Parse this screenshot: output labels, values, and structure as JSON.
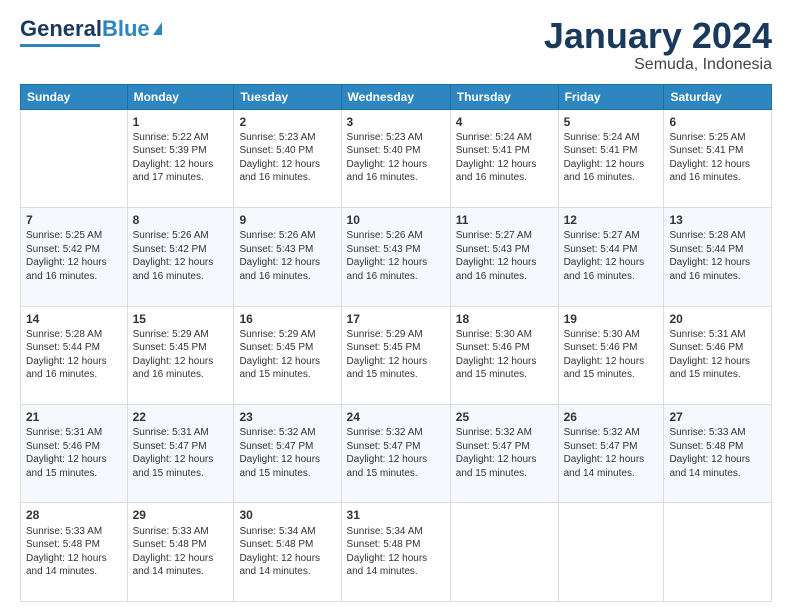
{
  "header": {
    "logo": {
      "text_general": "General",
      "text_blue": "Blue"
    },
    "title": "January 2024",
    "subtitle": "Semuda, Indonesia"
  },
  "calendar": {
    "days_header": [
      "Sunday",
      "Monday",
      "Tuesday",
      "Wednesday",
      "Thursday",
      "Friday",
      "Saturday"
    ],
    "weeks": [
      [
        {
          "day": "",
          "info": ""
        },
        {
          "day": "1",
          "info": "Sunrise: 5:22 AM\nSunset: 5:39 PM\nDaylight: 12 hours\nand 17 minutes."
        },
        {
          "day": "2",
          "info": "Sunrise: 5:23 AM\nSunset: 5:40 PM\nDaylight: 12 hours\nand 16 minutes."
        },
        {
          "day": "3",
          "info": "Sunrise: 5:23 AM\nSunset: 5:40 PM\nDaylight: 12 hours\nand 16 minutes."
        },
        {
          "day": "4",
          "info": "Sunrise: 5:24 AM\nSunset: 5:41 PM\nDaylight: 12 hours\nand 16 minutes."
        },
        {
          "day": "5",
          "info": "Sunrise: 5:24 AM\nSunset: 5:41 PM\nDaylight: 12 hours\nand 16 minutes."
        },
        {
          "day": "6",
          "info": "Sunrise: 5:25 AM\nSunset: 5:41 PM\nDaylight: 12 hours\nand 16 minutes."
        }
      ],
      [
        {
          "day": "7",
          "info": "Sunrise: 5:25 AM\nSunset: 5:42 PM\nDaylight: 12 hours\nand 16 minutes."
        },
        {
          "day": "8",
          "info": "Sunrise: 5:26 AM\nSunset: 5:42 PM\nDaylight: 12 hours\nand 16 minutes."
        },
        {
          "day": "9",
          "info": "Sunrise: 5:26 AM\nSunset: 5:43 PM\nDaylight: 12 hours\nand 16 minutes."
        },
        {
          "day": "10",
          "info": "Sunrise: 5:26 AM\nSunset: 5:43 PM\nDaylight: 12 hours\nand 16 minutes."
        },
        {
          "day": "11",
          "info": "Sunrise: 5:27 AM\nSunset: 5:43 PM\nDaylight: 12 hours\nand 16 minutes."
        },
        {
          "day": "12",
          "info": "Sunrise: 5:27 AM\nSunset: 5:44 PM\nDaylight: 12 hours\nand 16 minutes."
        },
        {
          "day": "13",
          "info": "Sunrise: 5:28 AM\nSunset: 5:44 PM\nDaylight: 12 hours\nand 16 minutes."
        }
      ],
      [
        {
          "day": "14",
          "info": "Sunrise: 5:28 AM\nSunset: 5:44 PM\nDaylight: 12 hours\nand 16 minutes."
        },
        {
          "day": "15",
          "info": "Sunrise: 5:29 AM\nSunset: 5:45 PM\nDaylight: 12 hours\nand 16 minutes."
        },
        {
          "day": "16",
          "info": "Sunrise: 5:29 AM\nSunset: 5:45 PM\nDaylight: 12 hours\nand 15 minutes."
        },
        {
          "day": "17",
          "info": "Sunrise: 5:29 AM\nSunset: 5:45 PM\nDaylight: 12 hours\nand 15 minutes."
        },
        {
          "day": "18",
          "info": "Sunrise: 5:30 AM\nSunset: 5:46 PM\nDaylight: 12 hours\nand 15 minutes."
        },
        {
          "day": "19",
          "info": "Sunrise: 5:30 AM\nSunset: 5:46 PM\nDaylight: 12 hours\nand 15 minutes."
        },
        {
          "day": "20",
          "info": "Sunrise: 5:31 AM\nSunset: 5:46 PM\nDaylight: 12 hours\nand 15 minutes."
        }
      ],
      [
        {
          "day": "21",
          "info": "Sunrise: 5:31 AM\nSunset: 5:46 PM\nDaylight: 12 hours\nand 15 minutes."
        },
        {
          "day": "22",
          "info": "Sunrise: 5:31 AM\nSunset: 5:47 PM\nDaylight: 12 hours\nand 15 minutes."
        },
        {
          "day": "23",
          "info": "Sunrise: 5:32 AM\nSunset: 5:47 PM\nDaylight: 12 hours\nand 15 minutes."
        },
        {
          "day": "24",
          "info": "Sunrise: 5:32 AM\nSunset: 5:47 PM\nDaylight: 12 hours\nand 15 minutes."
        },
        {
          "day": "25",
          "info": "Sunrise: 5:32 AM\nSunset: 5:47 PM\nDaylight: 12 hours\nand 15 minutes."
        },
        {
          "day": "26",
          "info": "Sunrise: 5:32 AM\nSunset: 5:47 PM\nDaylight: 12 hours\nand 14 minutes."
        },
        {
          "day": "27",
          "info": "Sunrise: 5:33 AM\nSunset: 5:48 PM\nDaylight: 12 hours\nand 14 minutes."
        }
      ],
      [
        {
          "day": "28",
          "info": "Sunrise: 5:33 AM\nSunset: 5:48 PM\nDaylight: 12 hours\nand 14 minutes."
        },
        {
          "day": "29",
          "info": "Sunrise: 5:33 AM\nSunset: 5:48 PM\nDaylight: 12 hours\nand 14 minutes."
        },
        {
          "day": "30",
          "info": "Sunrise: 5:34 AM\nSunset: 5:48 PM\nDaylight: 12 hours\nand 14 minutes."
        },
        {
          "day": "31",
          "info": "Sunrise: 5:34 AM\nSunset: 5:48 PM\nDaylight: 12 hours\nand 14 minutes."
        },
        {
          "day": "",
          "info": ""
        },
        {
          "day": "",
          "info": ""
        },
        {
          "day": "",
          "info": ""
        }
      ]
    ]
  }
}
